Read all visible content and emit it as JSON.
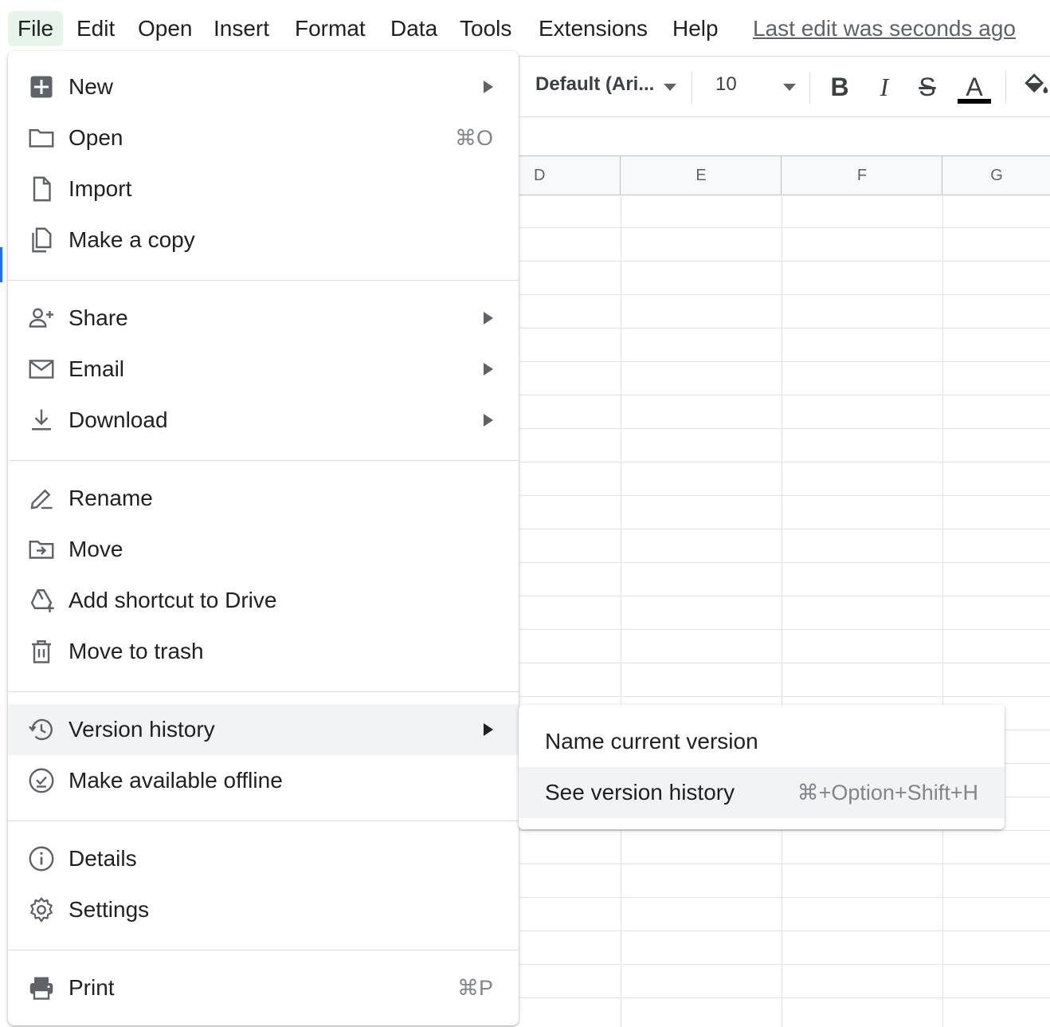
{
  "menubar": {
    "items": [
      "File",
      "Edit",
      "Open",
      "Insert",
      "Format",
      "Data",
      "Tools",
      "Extensions",
      "Help"
    ],
    "active": "File",
    "last_edit": "Last edit was seconds ago"
  },
  "toolbar": {
    "font": "Default (Ari...",
    "font_size": "10",
    "bold_icon": "B",
    "italic_icon": "I",
    "strike_icon": "S",
    "text_color_icon": "A",
    "text_color": "#000000"
  },
  "grid": {
    "columns": [
      "D",
      "E",
      "F",
      "G"
    ]
  },
  "file_menu": {
    "items": [
      {
        "label": "New",
        "icon": "new-spreadsheet-icon",
        "submenu": true
      },
      {
        "label": "Open",
        "icon": "folder-icon",
        "shortcut": "⌘O"
      },
      {
        "label": "Import",
        "icon": "file-icon"
      },
      {
        "label": "Make a copy",
        "icon": "copy-icon"
      },
      {
        "label": "Share",
        "icon": "person-add-icon",
        "submenu": true
      },
      {
        "label": "Email",
        "icon": "mail-icon",
        "submenu": true
      },
      {
        "label": "Download",
        "icon": "download-icon",
        "submenu": true
      },
      {
        "label": "Rename",
        "icon": "pencil-icon"
      },
      {
        "label": "Move",
        "icon": "folder-move-icon"
      },
      {
        "label": "Add shortcut to Drive",
        "icon": "drive-shortcut-icon"
      },
      {
        "label": "Move to trash",
        "icon": "trash-icon"
      },
      {
        "label": "Version history",
        "icon": "history-icon",
        "submenu": true,
        "highlighted": true
      },
      {
        "label": "Make available offline",
        "icon": "offline-check-icon"
      },
      {
        "label": "Details",
        "icon": "info-icon"
      },
      {
        "label": "Settings",
        "icon": "gear-icon"
      },
      {
        "label": "Print",
        "icon": "printer-icon",
        "shortcut": "⌘P"
      }
    ]
  },
  "version_submenu": {
    "items": [
      {
        "label": "Name current version"
      },
      {
        "label": "See version history",
        "shortcut": "⌘+Option+Shift+H",
        "highlighted": true
      }
    ]
  },
  "colors": {
    "active_menu_bg": "#e6f4ea",
    "hover_bg": "#f1f3f4",
    "grid_line": "#e2e3e3",
    "header_bg": "#f8f9fa"
  }
}
